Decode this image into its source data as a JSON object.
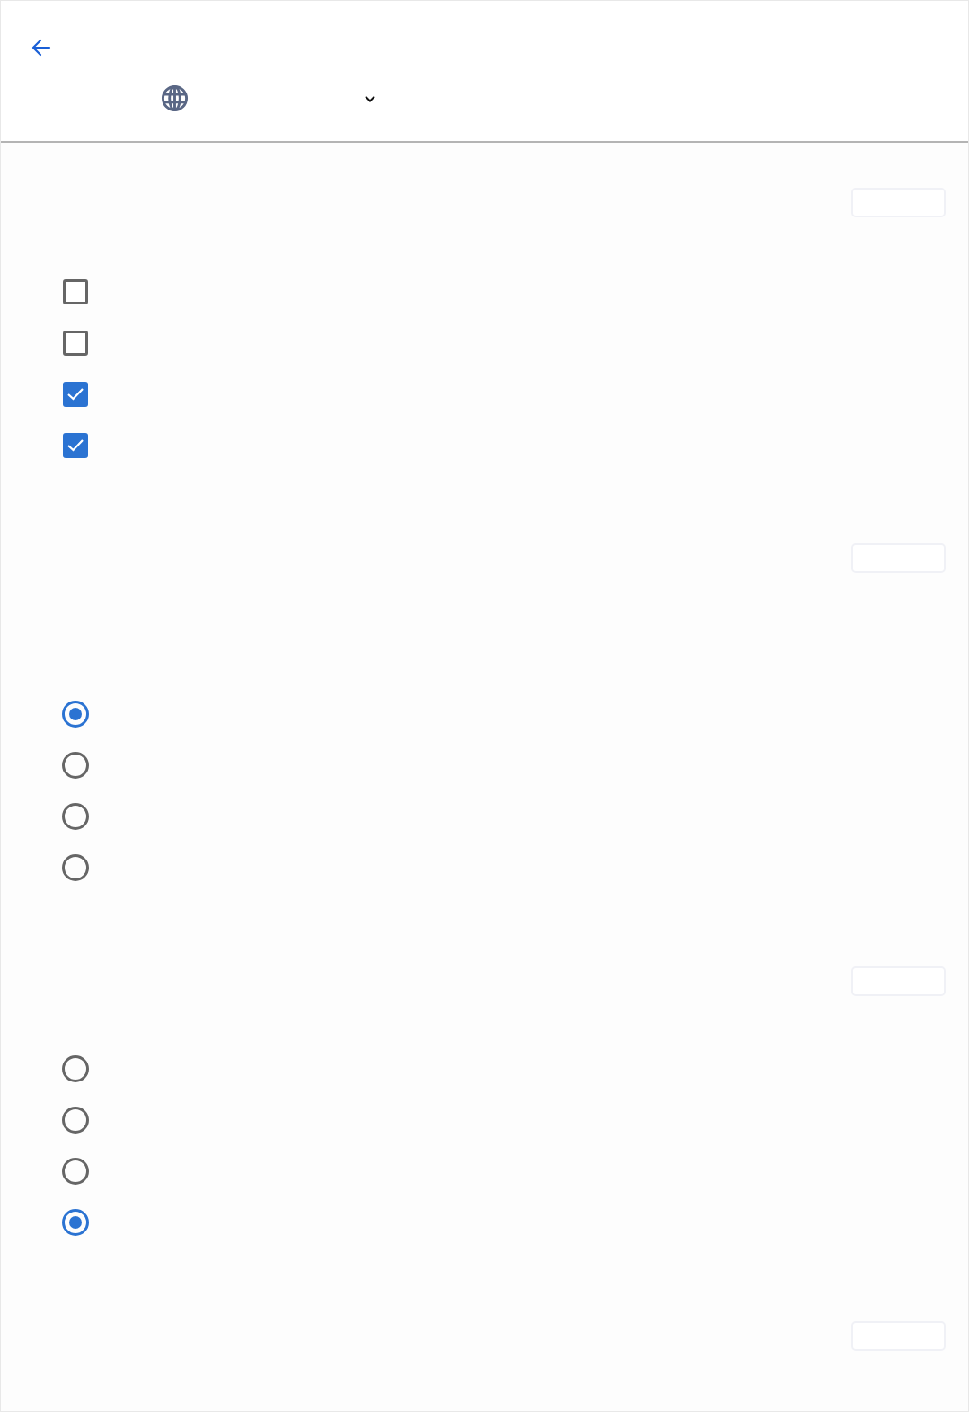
{
  "sections": [
    {
      "kind": "checkboxes",
      "options": [
        {
          "checked": false
        },
        {
          "checked": false
        },
        {
          "checked": true
        },
        {
          "checked": true
        }
      ]
    },
    {
      "kind": "radios",
      "options": [
        {
          "selected": true
        },
        {
          "selected": false
        },
        {
          "selected": false
        },
        {
          "selected": false
        }
      ]
    },
    {
      "kind": "radios",
      "options": [
        {
          "selected": false
        },
        {
          "selected": false
        },
        {
          "selected": false
        },
        {
          "selected": true
        }
      ]
    },
    {
      "kind": "blank"
    }
  ]
}
